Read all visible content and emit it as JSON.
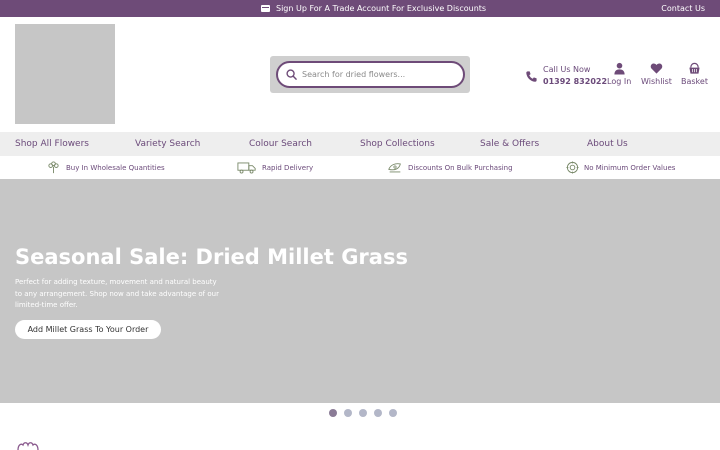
{
  "topbar": {
    "promo_text": "Sign Up For A Trade Account For Exclusive Discounts",
    "promo_icon": "card-icon",
    "contact_label": "Contact Us"
  },
  "header": {
    "search_placeholder": "Search for dried flowers...",
    "call_label": "Call Us Now",
    "phone": "01392 832022",
    "login_label": "Log In",
    "wishlist_label": "Wishlist",
    "basket_label": "Basket"
  },
  "nav": {
    "items": [
      {
        "label": "Shop All Flowers"
      },
      {
        "label": "Variety Search"
      },
      {
        "label": "Colour Search"
      },
      {
        "label": "Shop Collections"
      },
      {
        "label": "Sale & Offers"
      },
      {
        "label": "About Us"
      }
    ]
  },
  "usp": {
    "items": [
      {
        "label": "Buy In Wholesale Quantities",
        "icon": "flower-icon"
      },
      {
        "label": "Rapid Delivery",
        "icon": "truck-icon"
      },
      {
        "label": "Discounts On Bulk Purchasing",
        "icon": "bulk-icon"
      },
      {
        "label": "No Minimum Order Values",
        "icon": "badge-icon"
      }
    ]
  },
  "hero": {
    "title": "Seasonal Sale: Dried Millet Grass",
    "description": "Perfect for adding texture, movement and natural beauty to any arrangement. Shop now and take advantage of our limited-time offer.",
    "cta_label": "Add Millet Grass To Your Order"
  },
  "carousel": {
    "slide_count": 5,
    "active_index": 0
  },
  "colors": {
    "brand": "#6e4b78",
    "placeholder_grey": "#c6c6c6",
    "nav_bg": "#eeeeee"
  }
}
